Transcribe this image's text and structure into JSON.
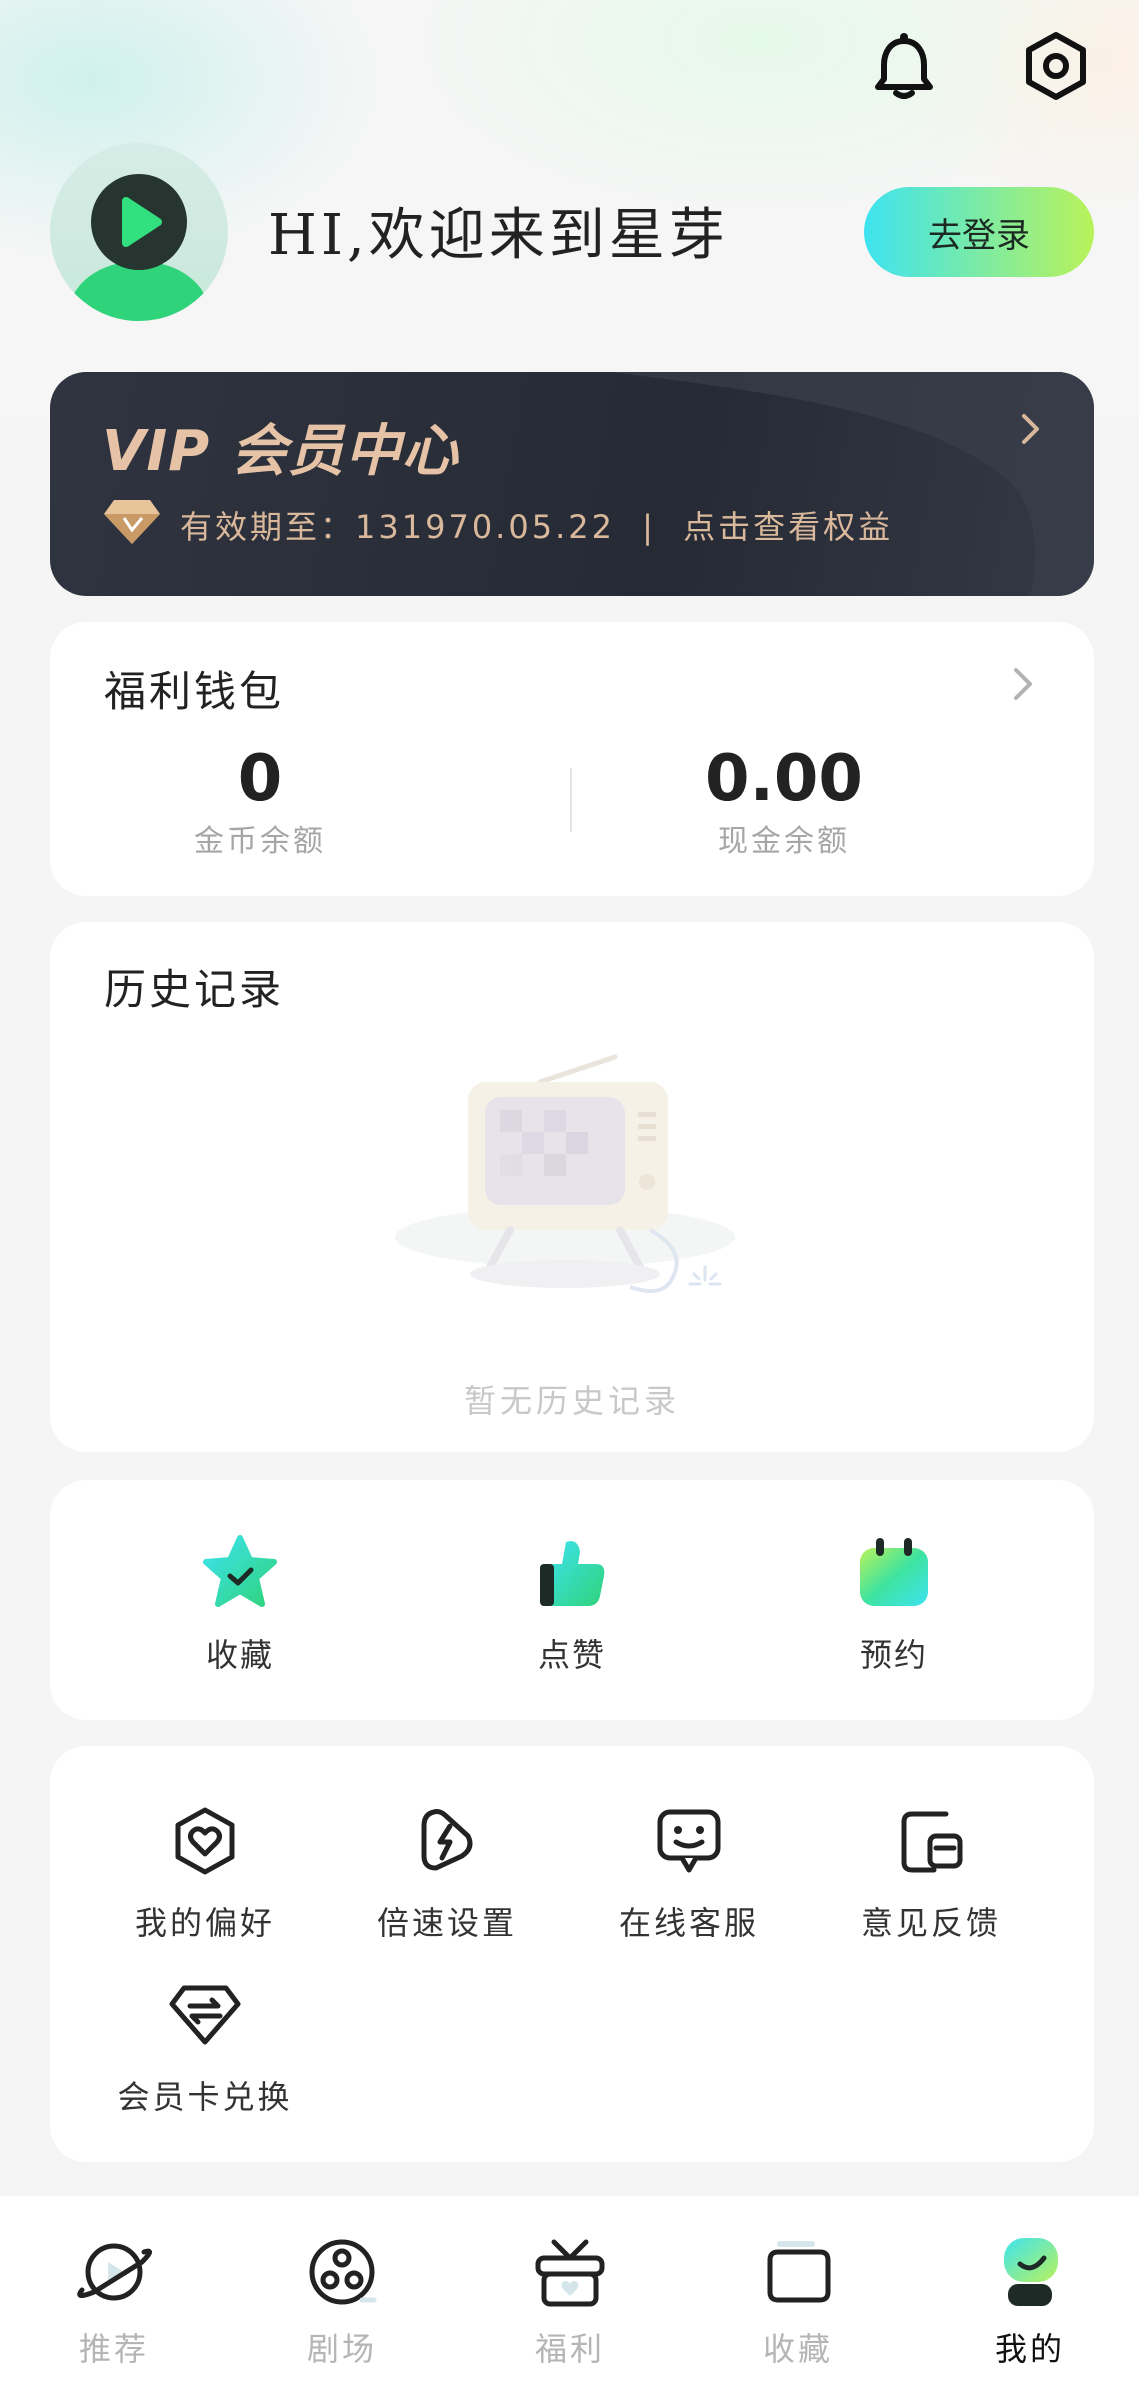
{
  "header": {
    "bell_icon": "bell-icon",
    "settings_icon": "settings-icon"
  },
  "profile": {
    "greeting": "HI,欢迎来到星芽",
    "login_label": "去登录"
  },
  "vip": {
    "title": "VIP 会员中心",
    "expiry_label": "有效期至：",
    "expiry_value": "131970.05.22",
    "separator": "|",
    "benefits_link": "点击查看权益"
  },
  "wallet": {
    "title": "福利钱包",
    "coins": {
      "value": "0",
      "label": "金币余额"
    },
    "cash": {
      "value": "0.00",
      "label": "现金余额"
    }
  },
  "history": {
    "title": "历史记录",
    "empty_text": "暂无历史记录"
  },
  "quick": [
    {
      "label": "收藏",
      "icon": "star-icon"
    },
    {
      "label": "点赞",
      "icon": "thumbs-up-icon"
    },
    {
      "label": "预约",
      "icon": "calendar-icon"
    }
  ],
  "tools": [
    {
      "label": "我的偏好",
      "icon": "heart-shield-icon"
    },
    {
      "label": "倍速设置",
      "icon": "speed-icon"
    },
    {
      "label": "在线客服",
      "icon": "chat-icon"
    },
    {
      "label": "意见反馈",
      "icon": "feedback-icon"
    },
    {
      "label": "会员卡兑换",
      "icon": "exchange-icon"
    }
  ],
  "nav": [
    {
      "label": "推荐",
      "active": false
    },
    {
      "label": "剧场",
      "active": false
    },
    {
      "label": "福利",
      "active": false
    },
    {
      "label": "收藏",
      "active": false
    },
    {
      "label": "我的",
      "active": true
    }
  ],
  "colors": {
    "accent_start": "#3ee3f0",
    "accent_end": "#b9f25a",
    "vip_gold": "#e6c3a7"
  }
}
